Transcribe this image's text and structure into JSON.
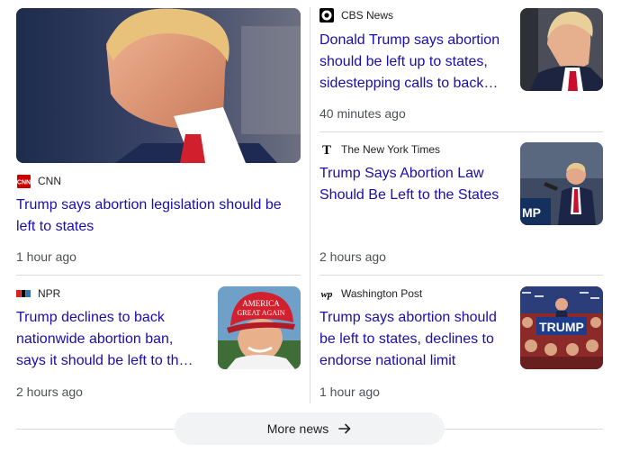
{
  "stories": [
    {
      "source": "CNN",
      "logo": "cnn-logo",
      "headline": "Trump says abortion legislation should be left to states",
      "time": "1 hour ago"
    },
    {
      "source": "CBS News",
      "logo": "cbs-eye-logo",
      "headline": "Donald Trump says abortion should be left up to states, sidestepping calls to back…",
      "time": "40 minutes ago"
    },
    {
      "source": "The New York Times",
      "logo": "nyt-logo",
      "headline": "Trump Says Abortion Law Should Be Left to the States",
      "time": "2 hours ago"
    },
    {
      "source": "NPR",
      "logo": "npr-logo",
      "headline": "Trump declines to back nationwide abortion ban, says it should be left to th…",
      "time": "2 hours ago"
    },
    {
      "source": "Washington Post",
      "logo": "wapo-logo",
      "headline": "Trump says abortion should be left to states, declines to endorse national limit",
      "time": "1 hour ago"
    }
  ],
  "thumb_text": {
    "hat_line1": "AMERICA",
    "hat_line2": "GREAT AGAIN",
    "sign_text": "TRUMP",
    "podium_text": "MP"
  },
  "more_news": {
    "label": "More news",
    "icon": "arrow-right-icon"
  },
  "colors": {
    "headline": "#1a0dab",
    "meta": "#4d5156",
    "divider": "#dadce0",
    "cnn_red": "#cc0000"
  }
}
